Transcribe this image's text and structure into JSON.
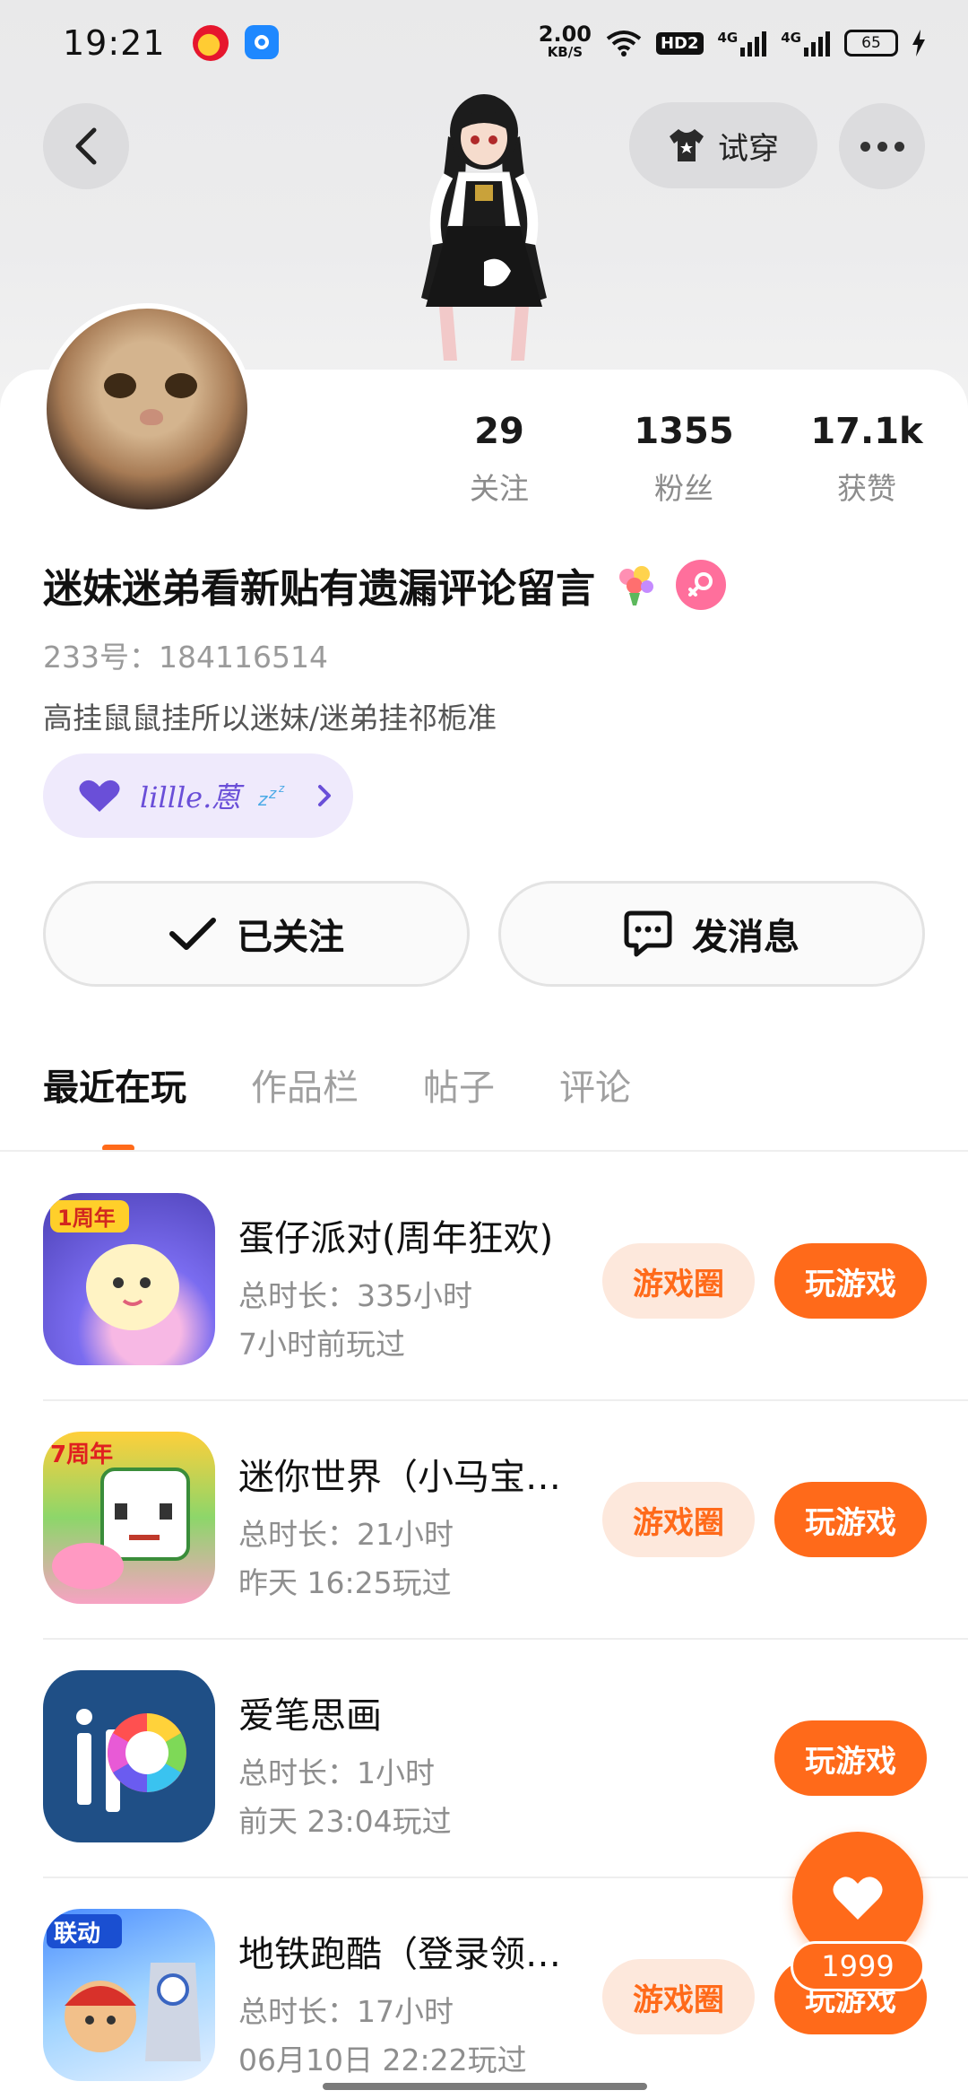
{
  "status_bar": {
    "time": "19:21",
    "net_speed_value": "2.00",
    "net_speed_unit": "KB/S",
    "hd_label": "HD2",
    "signal1_label": "4G",
    "signal2_label": "4G",
    "battery_level": "65"
  },
  "header": {
    "tryon_label": "试穿"
  },
  "profile": {
    "stats": [
      {
        "value": "29",
        "label": "关注"
      },
      {
        "value": "1355",
        "label": "粉丝"
      },
      {
        "value": "17.1k",
        "label": "获赞"
      }
    ],
    "nickname": "迷妹迷弟看新贴有遗漏评论留言",
    "user_id": "233号：184116514",
    "bio": "高挂鼠鼠挂所以迷妹/迷弟挂祁栀准",
    "fan_badge_text": "lillle.蒽",
    "follow_label": "已关注",
    "message_label": "发消息"
  },
  "tabs": [
    "最近在玩",
    "作品栏",
    "帖子",
    "评论"
  ],
  "games": [
    {
      "title": "蛋仔派对(周年狂欢)",
      "duration": "总时长：335小时",
      "last_played": "7小时前玩过",
      "icon_badge": "1周年",
      "circle_label": "游戏圈",
      "play_label": "玩游戏"
    },
    {
      "title": "迷你世界（小马宝…",
      "duration": "总时长：21小时",
      "last_played": "昨天 16:25玩过",
      "icon_badge": "7周年",
      "circle_label": "游戏圈",
      "play_label": "玩游戏"
    },
    {
      "title": "爱笔思画",
      "duration": "总时长：1小时",
      "last_played": "前天 23:04玩过",
      "icon_badge": "",
      "circle_label": "",
      "play_label": "玩游戏"
    },
    {
      "title": "地铁跑酷（登录领…",
      "duration": "总时长：17小时",
      "last_played": "06月10日 22:22玩过",
      "icon_badge": "联动",
      "circle_label": "游戏圈",
      "play_label": "玩游戏"
    }
  ],
  "like_fab": {
    "count": "1999"
  },
  "colors": {
    "accent": "#ff6a1a",
    "accent_light": "#fde8dc",
    "badge_purple": "#6a4fd8",
    "female_pink": "#ff6f9c"
  }
}
